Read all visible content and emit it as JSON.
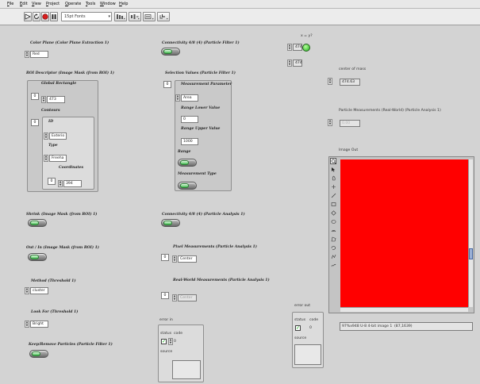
{
  "menubar": {
    "items": [
      {
        "label": "File",
        "ul": "F",
        "rest": "ile"
      },
      {
        "label": "Edit",
        "ul": "E",
        "rest": "dit"
      },
      {
        "label": "View",
        "ul": "V",
        "rest": "iew"
      },
      {
        "label": "Project",
        "ul": "P",
        "rest": "roject"
      },
      {
        "label": "Operate",
        "ul": "O",
        "rest": "perate"
      },
      {
        "label": "Tools",
        "ul": "T",
        "rest": "ools"
      },
      {
        "label": "Window",
        "ul": "W",
        "rest": "indow"
      },
      {
        "label": "Help",
        "ul": "H",
        "rest": "elp"
      }
    ]
  },
  "toolbar": {
    "run_icon": "run-arrow-icon",
    "run_continuous_icon": "run-continuously-icon",
    "abort_icon": "abort-icon",
    "pause_icon": "pause-icon",
    "font_selector": "15pt Fonts",
    "align_icon": "align-objects-icon",
    "distribute_icon": "distribute-objects-icon",
    "resize_icon": "resize-objects-icon",
    "reorder_icon": "reorder-icon"
  },
  "controls": {
    "color_plane": {
      "label": "Color Plane (Color Plane Extraction 1)",
      "value": "Red"
    },
    "roi_descriptor": {
      "label": "ROI Descriptor (Image Mask (from ROI) 1)",
      "global_rect_label": "Global Rectangle",
      "global_rect_index": "0",
      "global_rect_value": "473",
      "contours_label": "Contours",
      "contours_index": "0",
      "id_label": "ID",
      "id_value": "Exterio",
      "type_label": "Type",
      "type_value": "Freeha",
      "coords_label": "Coordinates",
      "coords_index": "0",
      "coords_value": "394"
    },
    "shrink": {
      "label": "Shrink (Image Mask (from ROI) 1)"
    },
    "out_in": {
      "label": "Out / In (Image Mask (from ROI) 1)"
    },
    "method": {
      "label": "Method (Threshold 1)",
      "value": "cluster"
    },
    "look_for": {
      "label": "Look For (Threshold 1)",
      "value": "Bright"
    },
    "keep_remove": {
      "label": "Keep/Remove Particles (Particle Filter 1)"
    },
    "connectivity_filter": {
      "label": "Connectivity 4/8 (4) (Particle Filter 1)"
    },
    "selection_values": {
      "label": "Selection Values (Particle Filter 1)",
      "index": "0",
      "measurement_label": "Measurement Parameter",
      "measurement_value": "Area",
      "range_lower_label": "Range Lower Value",
      "range_lower_value": "0",
      "range_upper_label": "Range Upper Value",
      "range_upper_value": "1000",
      "range_label": "Range",
      "measurement_type_label": "Measurement Type"
    },
    "connectivity_analysis": {
      "label": "Connectivity 4/8 (4) (Particle Analysis 1)"
    },
    "pixel_measurements": {
      "label": "Pixel Measurements (Particle Analysis 1)",
      "index": "0",
      "value": "Center"
    },
    "real_world_measurements": {
      "label": "Real-World Measurements (Particle Analysis 1)",
      "index": "0",
      "value": "Center"
    },
    "xy": {
      "label": "x = y?",
      "x_value": "474",
      "y_value": "474"
    },
    "center_of_mass": {
      "label": "center of mass",
      "index": "0",
      "value": "474.63"
    },
    "particle_real_world": {
      "label": "Particle Measurements (Real-World) (Particle Analysis 1)",
      "index": "0",
      "value": "0.00"
    },
    "error_in": {
      "label": "error in",
      "status_label": "status",
      "code_label": "code",
      "code_value": "0",
      "source_label": "source"
    },
    "error_out": {
      "label": "error out",
      "status_label": "status",
      "code_label": "code",
      "code_value": "0",
      "source_label": "source"
    }
  },
  "image_out": {
    "label": "Image Out",
    "fill_color": "#ff0000",
    "status_info": "97%x948 U-8 4-bit image 1",
    "coords_info": "(87,1639)",
    "tools": [
      "zoom-icon",
      "pan-icon",
      "selection-icon",
      "point-icon",
      "line-icon",
      "rectangle-icon",
      "rotated-rectangle-icon",
      "oval-icon",
      "annulus-icon",
      "polygon-icon",
      "freehand-icon",
      "broken-line-icon",
      "freehand-line-icon"
    ]
  }
}
